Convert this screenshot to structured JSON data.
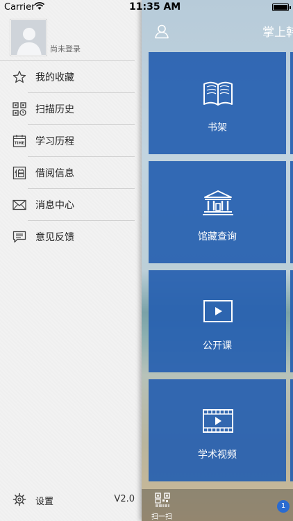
{
  "status_bar": {
    "carrier": "Carrier",
    "time": "11:35 AM"
  },
  "sidebar": {
    "login_text": "尚未登录",
    "menu": [
      {
        "label": "我的收藏",
        "icon": "star-icon"
      },
      {
        "label": "扫描历史",
        "icon": "qr-history-icon"
      },
      {
        "label": "学习历程",
        "icon": "time-calendar-icon"
      },
      {
        "label": "借阅信息",
        "icon": "borrow-icon"
      },
      {
        "label": "消息中心",
        "icon": "envelope-icon"
      },
      {
        "label": "意见反馈",
        "icon": "feedback-icon"
      }
    ],
    "settings_label": "设置",
    "version": "V2.0"
  },
  "main": {
    "title": "掌上韩",
    "tiles": [
      {
        "label": "书架",
        "icon": "book-icon"
      },
      {
        "label": "馆藏查询",
        "icon": "library-building-icon"
      },
      {
        "label": "公开课",
        "icon": "play-screen-icon"
      },
      {
        "label": "学术视频",
        "icon": "film-icon"
      }
    ],
    "tabbar": {
      "scan_label": "扫一扫",
      "badge": "1"
    }
  },
  "colors": {
    "tile": "#2660b0",
    "sidebar_bg": "#f2f2f2",
    "badge": "#2a6bd1"
  }
}
